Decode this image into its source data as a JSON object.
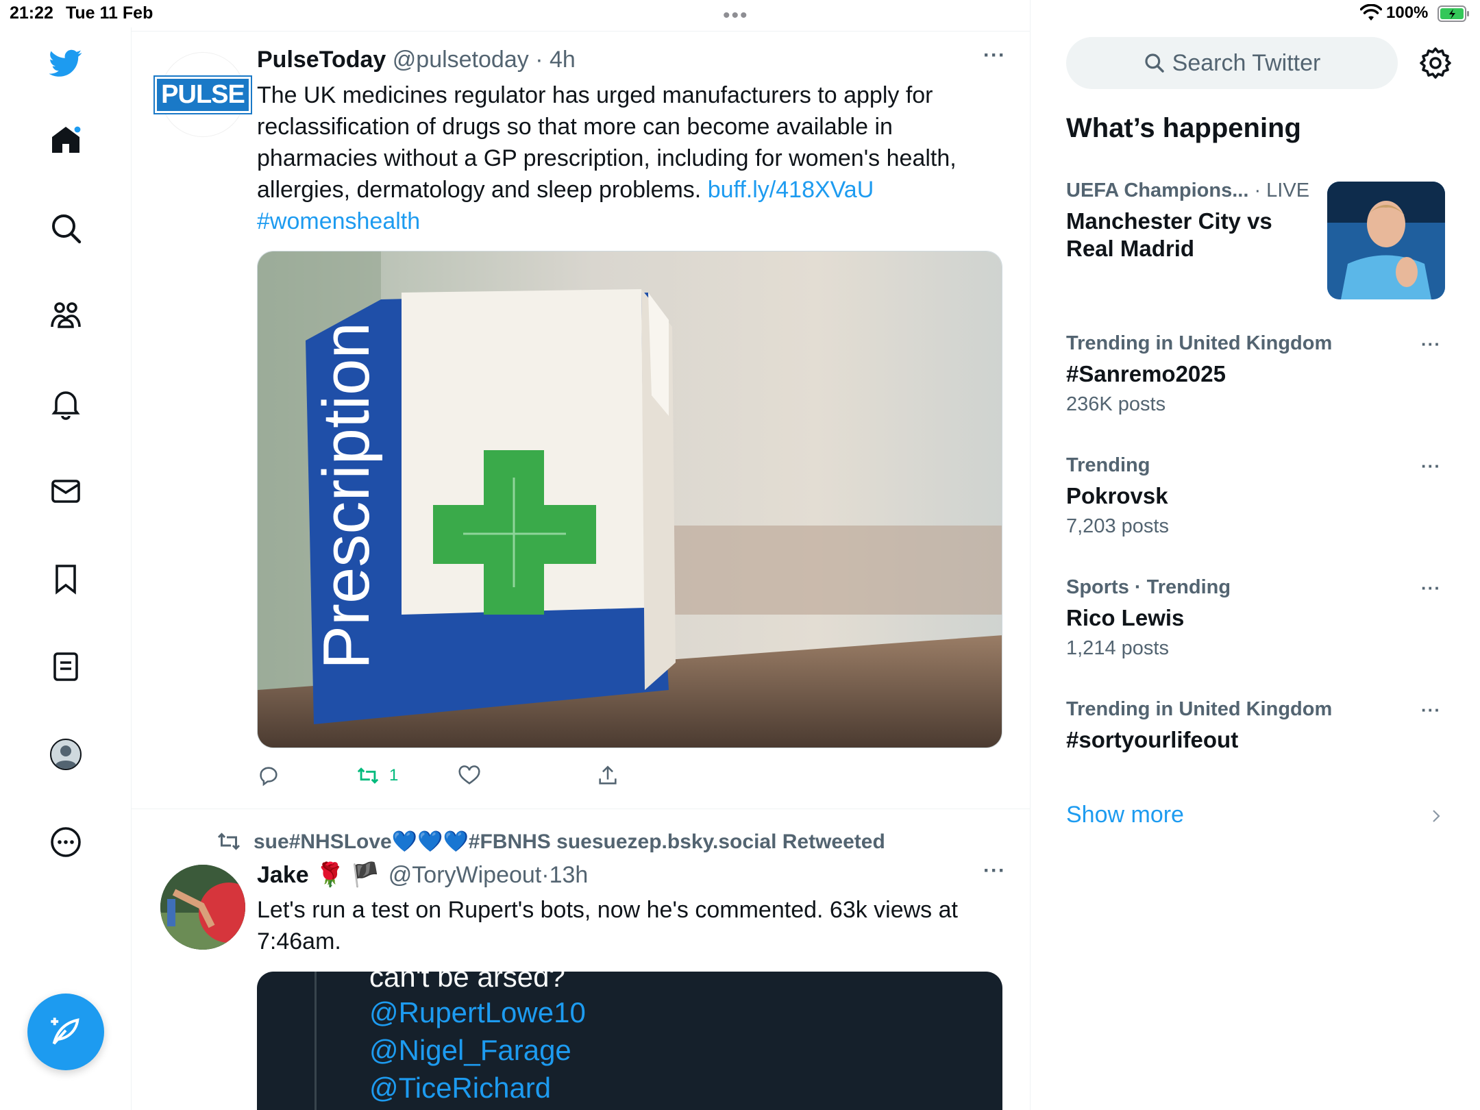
{
  "status_bar": {
    "time": "21:22",
    "date": "Tue 11 Feb",
    "multitask_dots": "•••",
    "battery": "100%"
  },
  "nav": {
    "items": [
      "twitter-logo",
      "home-icon",
      "search-icon",
      "communities-icon",
      "notifications-icon",
      "messages-icon",
      "bookmarks-icon",
      "lists-icon",
      "profile-icon",
      "more-icon"
    ],
    "compose_icon": "compose-icon"
  },
  "timeline": {
    "tweet1": {
      "avatar_text": "PULSE",
      "name": "PulseToday",
      "handle": "@pulsetoday",
      "separator": "·",
      "time": "4h",
      "more": "···",
      "text": "The UK medicines regulator has urged manufacturers to apply for reclassification of drugs so that more can become available in pharmacies without a GP prescription, including for women's health, allergies, dermatology and sleep problems.",
      "link": "buff.ly/418XVaU",
      "hashtag": "#womenshealth",
      "media_text": "Prescription",
      "actions": {
        "retweet_count": "1"
      }
    },
    "tweet2": {
      "retweeted_by": "sue#NHSLove💙💙💙#FBNHS suesuezep.bsky.social Retweeted",
      "name": "Jake",
      "name_emojis": "🌹 🏴",
      "handle": "@ToryWipeout",
      "separator": "·",
      "time": "13h",
      "more": "···",
      "text": "Let's run a test on Rupert's bots, now he's commented. 63k views at 7:46am.",
      "media": {
        "cut_text": "can't be arsed?",
        "mentions": [
          "@RupertLowe10",
          "@Nigel_Farage",
          "@TiceRichard"
        ]
      }
    }
  },
  "sidebar": {
    "search_placeholder": "Search Twitter",
    "heading": "What’s happening",
    "trends": [
      {
        "meta": "UEFA Champions...",
        "live": " · LIVE",
        "title": "Manchester City vs Real Madrid",
        "count": ""
      },
      {
        "meta": "Trending in United Kingdom",
        "title": "#Sanremo2025",
        "count": "236K posts"
      },
      {
        "meta": "Trending",
        "title": "Pokrovsk",
        "count": "7,203 posts"
      },
      {
        "meta": "Sports · Trending",
        "title": "Rico Lewis",
        "count": "1,214 posts"
      },
      {
        "meta": "Trending in United Kingdom",
        "title": "#sortyourlifeout",
        "count": ""
      }
    ],
    "trend_more": "···",
    "show_more": "Show more"
  },
  "colors": {
    "accent": "#1d9bf0",
    "retweet_green": "#00ba7c",
    "text_secondary": "#536471"
  }
}
